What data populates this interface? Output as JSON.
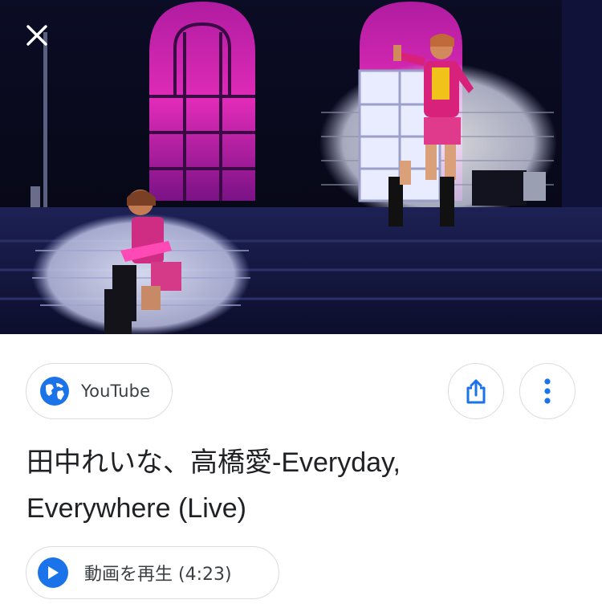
{
  "viewer": {
    "close_icon": "close-icon",
    "media_description_icon": "video-thumbnail"
  },
  "source": {
    "label": "YouTube",
    "icon": "globe-icon"
  },
  "actions": {
    "share_icon": "share-icon",
    "more_icon": "more-vert-icon"
  },
  "title": {
    "line1": "田中れいな、高橋愛-Everyday,",
    "line2": "Everywhere (Live)"
  },
  "play": {
    "label": "動画を再生",
    "duration": "(4:23)",
    "icon": "play-icon"
  },
  "colors": {
    "accent": "#1a73e8",
    "text_primary": "#202124",
    "text_secondary": "#3c4043",
    "chip_border": "#dadce0"
  }
}
